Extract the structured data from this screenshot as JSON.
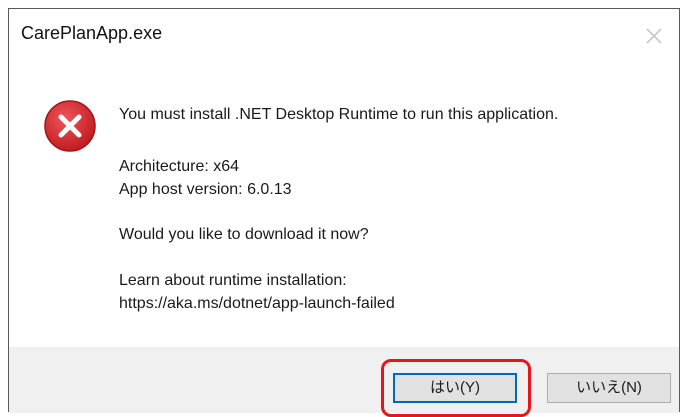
{
  "window": {
    "title": "CarePlanApp.exe",
    "close_icon": "close-icon"
  },
  "message": {
    "icon": "error-icon",
    "main": "You must install .NET Desktop Runtime to run this application.",
    "architecture": "Architecture: x64",
    "app_host_version": "App host version: 6.0.13",
    "question": "Would you like to download it now?",
    "learn_about": "Learn about runtime installation:",
    "url": "https://aka.ms/dotnet/app-launch-failed"
  },
  "buttons": {
    "yes_label": "はい(Y)",
    "no_label": "いいえ(N)"
  },
  "colors": {
    "error_red": "#d9262b",
    "highlight_red": "#e8151b",
    "focus_blue": "#0067c0",
    "footer_bg": "#f0f0f0"
  }
}
